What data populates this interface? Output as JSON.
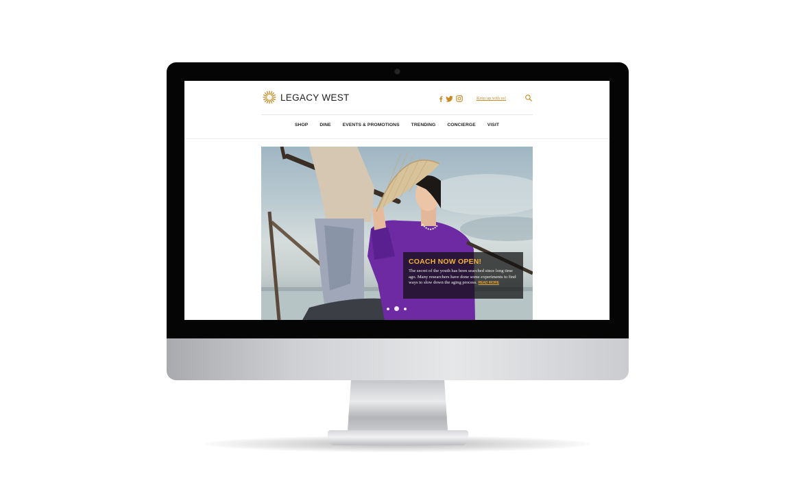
{
  "brand": {
    "name": "LEGACY WEST",
    "accent_color": "#c48a24"
  },
  "header": {
    "social_icons": [
      "facebook-icon",
      "twitter-icon",
      "instagram-icon"
    ],
    "keep_up_label": "Keep up with us!",
    "search_icon": "search-icon"
  },
  "nav": {
    "items": [
      {
        "label": "SHOP"
      },
      {
        "label": "DINE"
      },
      {
        "label": "EVENTS & PROMOTIONS"
      },
      {
        "label": "TRENDING"
      },
      {
        "label": "CONCIERGE"
      },
      {
        "label": "VISIT"
      }
    ]
  },
  "hero": {
    "title": "COACH NOW OPEN!",
    "body": "The secret of the youth has been searched since long time ago. Many researchers have done some experiments to find ways to slow down the aging process.",
    "read_more": "READ MORE",
    "slide_count": 3,
    "active_slide": 2,
    "title_color": "#f0b23a"
  }
}
